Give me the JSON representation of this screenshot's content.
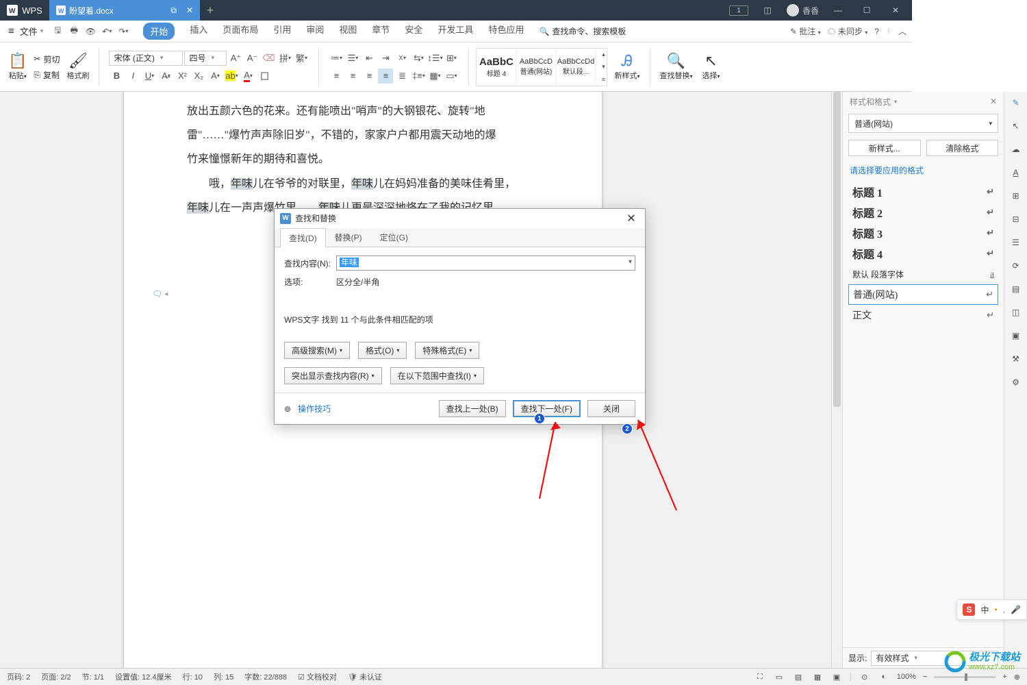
{
  "title": {
    "app": "WPS",
    "doc_name": "盼望着.docx",
    "user": "香香"
  },
  "quick": {
    "file": "文件"
  },
  "menu": {
    "tabs": [
      "开始",
      "插入",
      "页面布局",
      "引用",
      "审阅",
      "视图",
      "章节",
      "安全",
      "开发工具",
      "特色应用"
    ],
    "search": "查找命令、搜索模板",
    "comment": "批注",
    "sync": "未同步"
  },
  "ribbon": {
    "paste": "粘贴",
    "cut": "剪切",
    "copy": "复制",
    "painter": "格式刷",
    "font_name": "宋体 (正文)",
    "font_size": "四号",
    "style_new": "新样式",
    "find_replace": "查找替换",
    "select": "选择",
    "styles": [
      {
        "preview": "AaBbC",
        "name": "标题 4",
        "big": true
      },
      {
        "preview": "AaBbCcD",
        "name": "普通(网站)"
      },
      {
        "preview": "AaBbCcDd",
        "name": "默认段..."
      }
    ]
  },
  "doc": {
    "p1_1": "放出五颜六色的花来。还有能喷出\"哨声\"的大钢银花、旋转\"地",
    "p1_2": "雷\"……\"爆竹声声除旧岁\"，不错的，家家户户都用震天动地的爆",
    "p1_3": "竹来憧憬新年的期待和喜悦。",
    "p2_pre": "哦，",
    "hl": "年味",
    "p2_1": "儿在爷爷的对联里，",
    "p2_2": "儿在妈妈准备的美味佳肴里，",
    "p3_1": "儿在一声声爆竹里……",
    "p3_2": "儿更是深深地烙在了我的记忆里。"
  },
  "dialog": {
    "title": "查找和替换",
    "tabs": [
      "查找(D)",
      "替换(P)",
      "定位(G)"
    ],
    "label_content": "查找内容(N):",
    "value": "年味",
    "label_opts": "选项:",
    "opts_value": "区分全/半角",
    "result_msg": "WPS文字 找到 11 个与此条件相匹配的项",
    "btn_adv": "高级搜索(M)",
    "btn_fmt": "格式(O)",
    "btn_special": "特殊格式(E)",
    "btn_hl": "突出显示查找内容(R)",
    "btn_scope": "在以下范围中查找(I)",
    "tips": "操作技巧",
    "btn_prev": "查找上一处(B)",
    "btn_next": "查找下一处(F)",
    "btn_close": "关闭"
  },
  "sidepanel": {
    "title": "样式和格式",
    "current": "普通(网站)",
    "btn_new": "新样式...",
    "btn_clear": "清除格式",
    "hint": "请选择要应用的格式",
    "styles": [
      "标题 1",
      "标题 2",
      "标题 3",
      "标题 4",
      "默认 段落字体",
      "普通(网站)",
      "正文"
    ],
    "show_label": "显示:",
    "show_value": "有效样式"
  },
  "status": {
    "page_no": "页码: 2",
    "page": "页面: 2/2",
    "sec": "节: 1/1",
    "pos": "设置值: 12.4厘米",
    "row": "行: 10",
    "col": "列: 15",
    "chars": "字数: 22/888",
    "proof": "文档校对",
    "auth": "未认证"
  },
  "zoom": "100%",
  "float": {
    "ime": "中"
  },
  "watermark_text": "极光下载站",
  "watermark_url": "www.xz7.com"
}
